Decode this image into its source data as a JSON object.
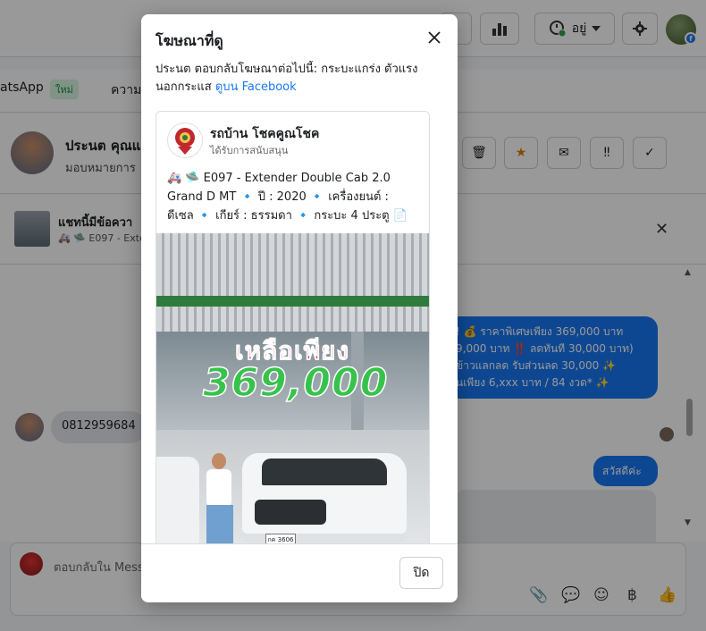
{
  "background": {
    "status_label": "อยู่",
    "tabs": {
      "whatsapp": "atsApp",
      "new_badge": "ใหม่",
      "other": "ความ"
    },
    "chat_header": {
      "name": "ประนต คุณแ",
      "subtitle": "มอบหมายการ"
    },
    "ad_bar": {
      "title": "แชทนี้มีข้อควา",
      "subtitle": "🚑 🛸 E097 - Exte"
    },
    "messages": {
      "blue_lines": [
        "! 💰 ราคาพิเศษเพียง 369,000 บาท",
        "9,000 บาท ‼️ ลดทันที 30,000 บาท)",
        "ข้าวแลกลด รับส่วนลด 30,000 ✨",
        "นเพียง 6,xxx บาท / 84 งวด* ✨"
      ],
      "phone": "0812959684",
      "greeting": "สวัสดีค่ะ"
    },
    "composer_placeholder": "ตอบกลับใน Mess"
  },
  "modal": {
    "title": "โฆษณาที่ดู",
    "description": "ประนต ตอบกลับโฆษณาต่อไปนี้: กระบะแกร่ง ตัวแรง นอกกระแส",
    "link": "ดูบน Facebook",
    "post": {
      "page_name": "รถบ้าน โชคคูณโชค",
      "sponsored": "ได้รับการสนับสนุน",
      "text_line1": "🚑 🛸 E097 - Extender Double Cab 2.0",
      "text_line2": "Grand D MT 🔹 ปี : 2020 🔹 เครื่องยนต์ :",
      "text_line3": "ดีเซล 🔹 เกียร์ : ธรรมดา 🔹 กระบะ 4 ประตู 📄 ..."
    },
    "image": {
      "headline": "เหลือเพียง",
      "price": "369,000",
      "plate": "กค 3606"
    },
    "footer_button": "ปิด"
  }
}
